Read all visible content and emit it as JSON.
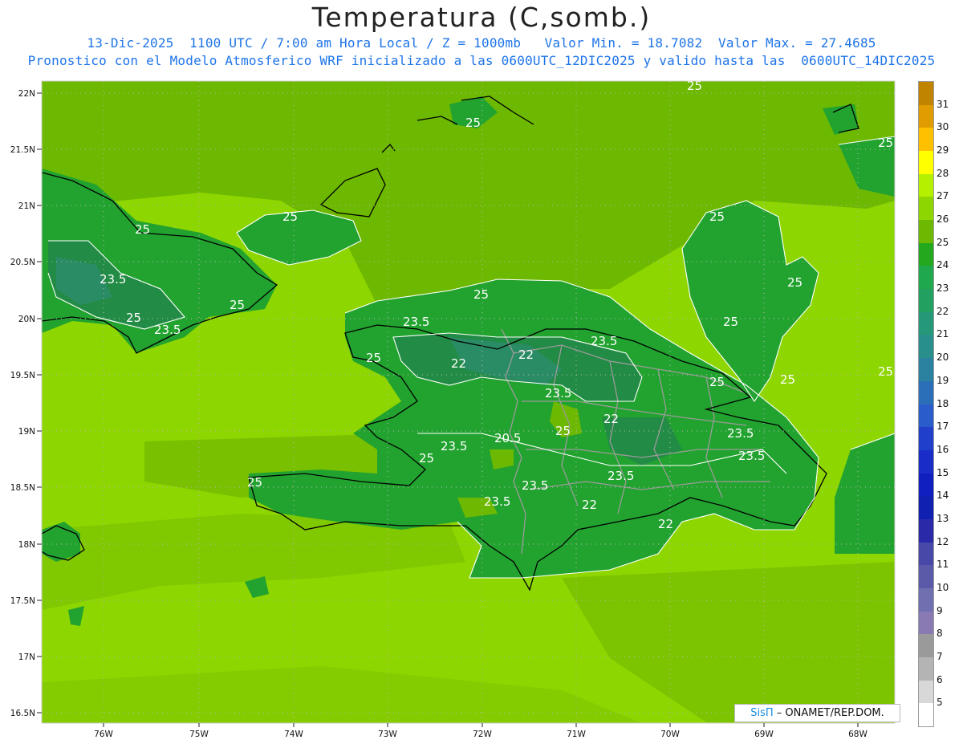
{
  "header": {
    "title": "Temperatura (C,somb.)",
    "subtitle_line1": "13-Dic-2025  1100 UTC / 7:00 am Hora Local / Z = 1000mb   Valor Min. = 18.7082  Valor Max. = 27.4685",
    "subtitle_line2": "Pronostico con el Modelo Atmosferico WRF inicializado a las 0600UTC_12DIC2025 y valido hasta las  0600UTC_14DIC2025"
  },
  "map": {
    "lat_labels": [
      "22N",
      "21.5N",
      "21N",
      "20.5N",
      "20N",
      "19.5N",
      "19N",
      "18.5N",
      "18N",
      "17.5N",
      "17N",
      "16.5N"
    ],
    "lon_labels": [
      "76W",
      "75W",
      "74W",
      "73W",
      "72W",
      "71W",
      "70W",
      "69W",
      "68W"
    ],
    "contour_labels": [
      "25",
      "25",
      "25",
      "25",
      "25",
      "25",
      "25",
      "25",
      "25",
      "25",
      "25",
      "25",
      "25",
      "25",
      "25",
      "25",
      "25",
      "25",
      "23.5",
      "23.5",
      "23.5",
      "23.5",
      "23.5",
      "23.5",
      "23.5",
      "23.5",
      "23.5",
      "23.5",
      "23.5",
      "22",
      "22",
      "22",
      "22",
      "22",
      "20.5"
    ],
    "colors": {
      "t25": "#6db800",
      "t24": "#1fa81f",
      "t23": "#22a32f",
      "t22": "#228b45",
      "t21": "#2a8c65",
      "t26": "#8ed600",
      "coast": "#000000",
      "border": "#9b9b9b",
      "contour": "#ffffff"
    }
  },
  "legend": {
    "labels": [
      "31",
      "30",
      "29",
      "28",
      "27",
      "26",
      "25",
      "24",
      "23",
      "22",
      "21",
      "20",
      "19",
      "18",
      "17",
      "16",
      "15",
      "14",
      "13",
      "12",
      "11",
      "10",
      "9",
      "8",
      "7",
      "6",
      "5"
    ],
    "colors": [
      "#c08400",
      "#e09c00",
      "#ffc000",
      "#ffff00",
      "#b4f000",
      "#8ed600",
      "#6db800",
      "#24a81e",
      "#1fa84c",
      "#22a060",
      "#249878",
      "#288f8c",
      "#2a82a0",
      "#2a6fb8",
      "#2a5ccc",
      "#2040cc",
      "#1a2cc8",
      "#1020c0",
      "#1020b0",
      "#2a2aa8",
      "#4848a8",
      "#5a5aa8",
      "#7070b0",
      "#8a7ab4",
      "#9a9a9a",
      "#b4b4b4",
      "#d8d8d8",
      "#ffffff"
    ]
  },
  "credit": {
    "sis": "SisΠ",
    "rest": " – ONAMET/REP.DOM."
  }
}
